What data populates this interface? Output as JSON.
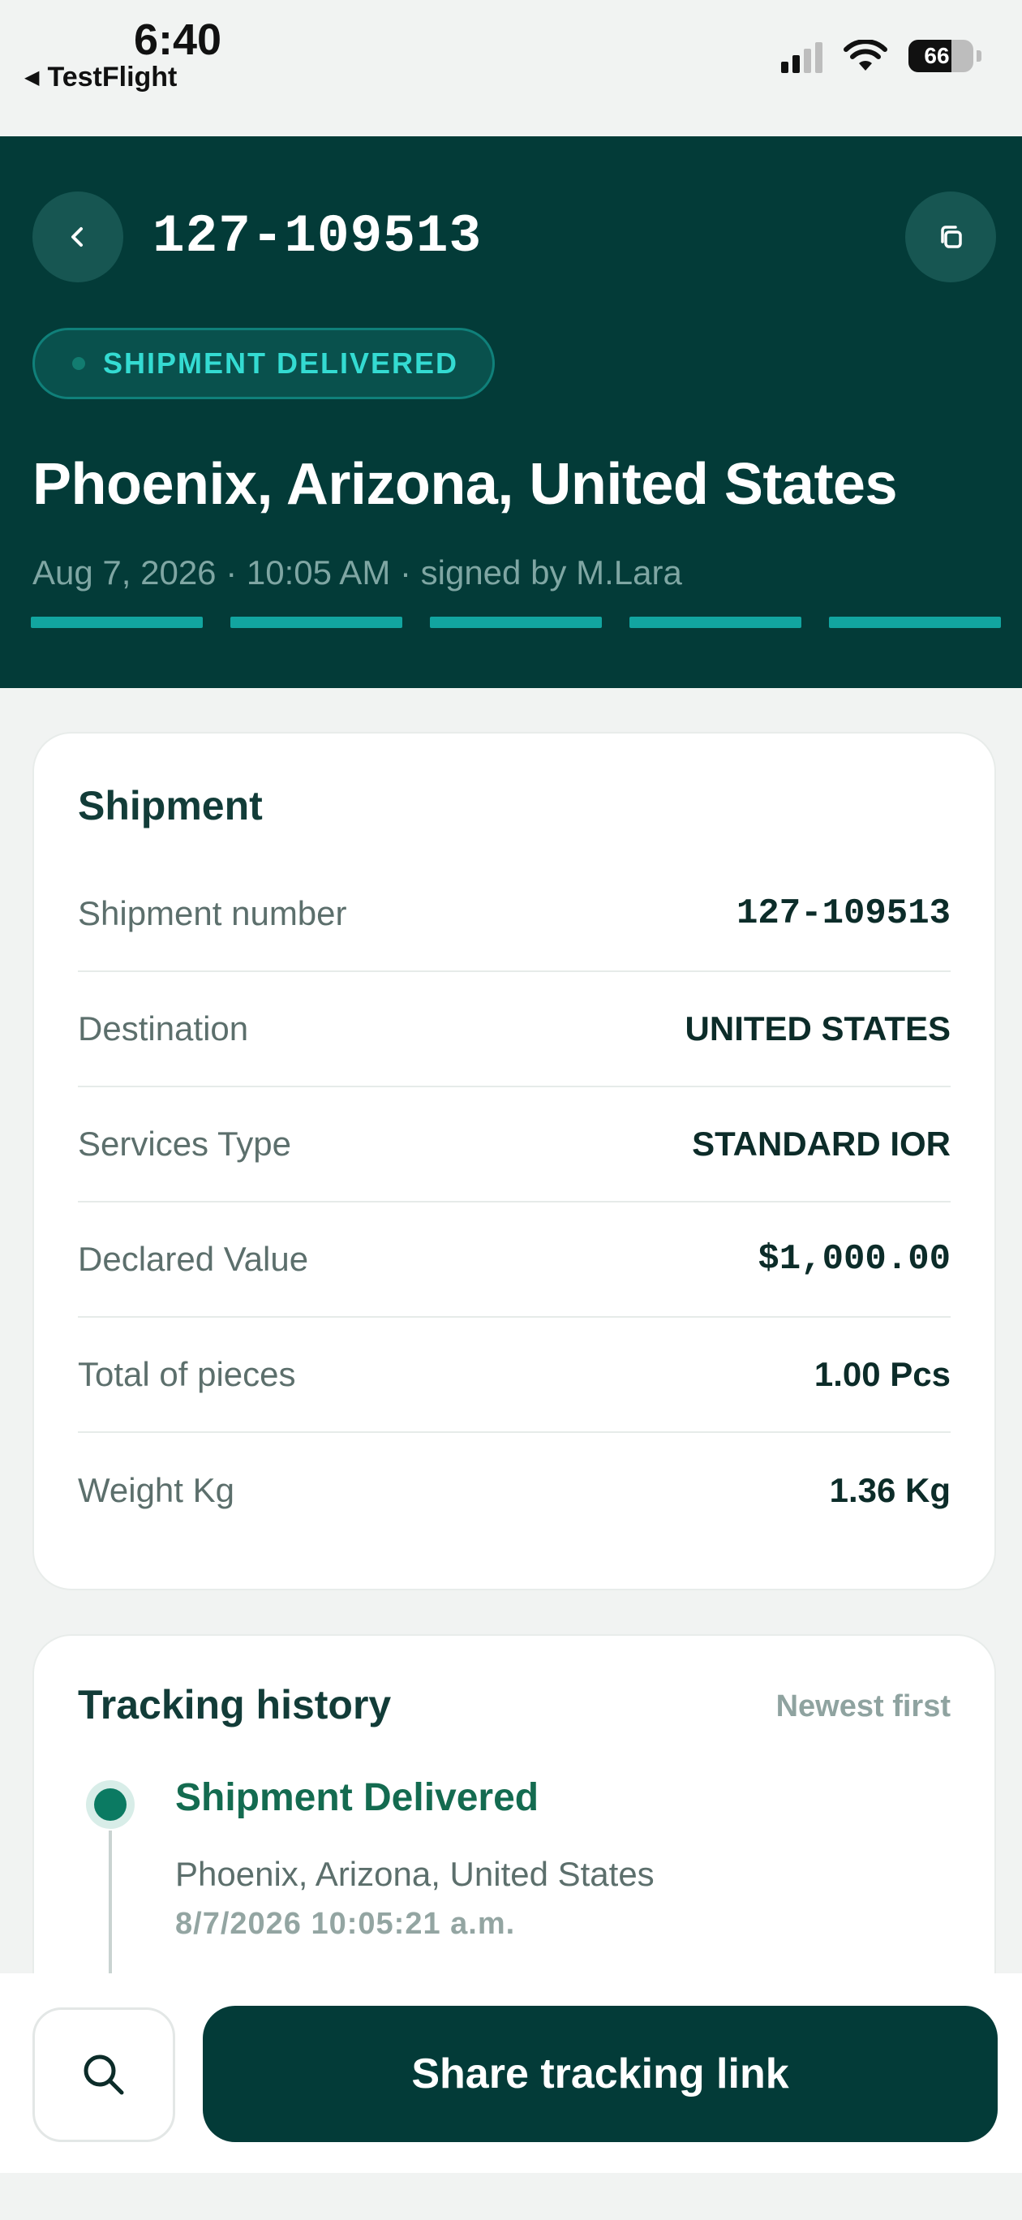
{
  "status_bar": {
    "time": "6:40",
    "back_app": "TestFlight",
    "battery": "66",
    "icons": [
      "signal-icon",
      "wifi-icon",
      "battery-icon"
    ]
  },
  "header": {
    "back_icon": "chevron-left-icon",
    "copy_icon": "copy-icon",
    "tracking_number": "127-109513",
    "status_badge": "SHIPMENT DELIVERED",
    "location": "Phoenix, Arizona, United States",
    "meta": "Aug 7, 2026 · 10:05 AM · signed by M.Lara",
    "progress_steps_completed": 5,
    "progress_steps_total": 5
  },
  "shipment": {
    "title": "Shipment",
    "rows": [
      {
        "label": "Shipment number",
        "value": "127-109513"
      },
      {
        "label": "Destination",
        "value": "UNITED STATES"
      },
      {
        "label": "Services Type",
        "value": "STANDARD IOR"
      },
      {
        "label": "Declared Value",
        "value": "$1,000.00"
      },
      {
        "label": "Total of pieces",
        "value": "1.00 Pcs"
      },
      {
        "label": "Weight Kg",
        "value": "1.36 Kg"
      }
    ]
  },
  "tracking": {
    "title": "Tracking history",
    "sort_label": "Newest first",
    "events": [
      {
        "title": "Shipment Delivered",
        "place": "Phoenix, Arizona, United States",
        "time": "8/7/2026 10:05:21 a.m."
      }
    ]
  },
  "bottom_bar": {
    "search_icon": "search-icon",
    "share_label": "Share tracking link"
  },
  "colors": {
    "header_bg": "#033b38",
    "accent_teal": "#12a5a0",
    "status_text": "#34dbd2",
    "delivered_green": "#0b7a62",
    "page_bg": "#f1f3f2"
  }
}
